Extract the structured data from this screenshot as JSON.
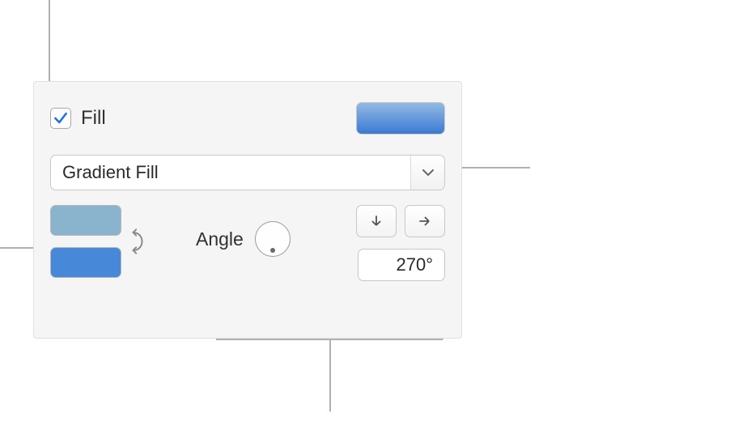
{
  "fill": {
    "checkbox_checked": true,
    "label": "Fill",
    "type_dropdown": "Gradient Fill",
    "preview": {
      "from": "#92b9e3",
      "to": "#3b7ad4"
    },
    "stops": {
      "color1": "#8ab3ce",
      "color2": "#4888d8"
    },
    "angle": {
      "label": "Angle",
      "value": "270°"
    }
  }
}
